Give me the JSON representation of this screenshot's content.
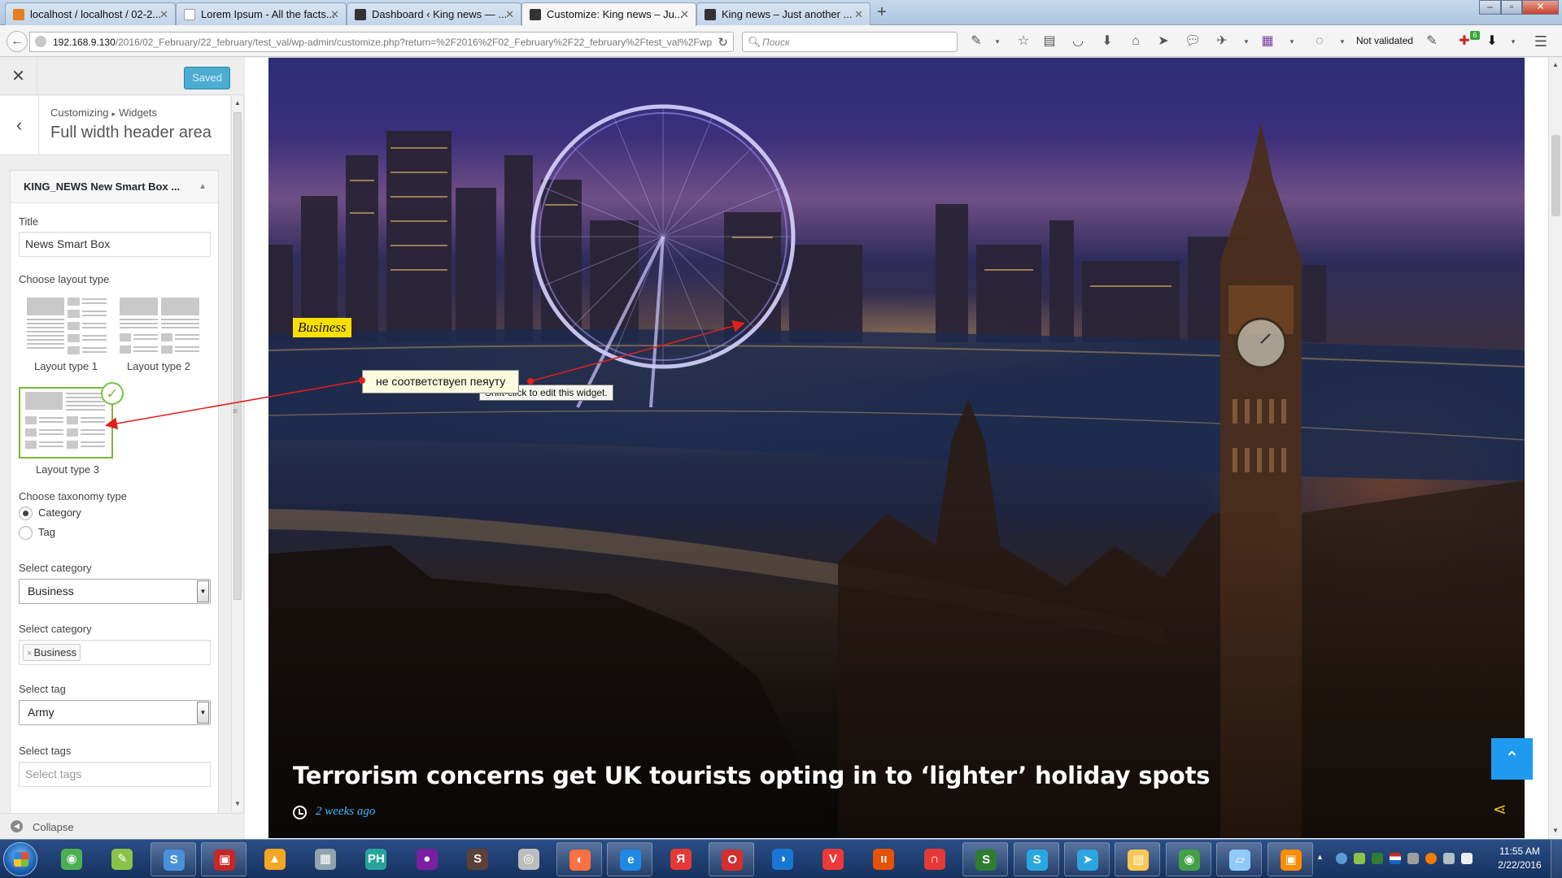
{
  "browser": {
    "tabs": [
      {
        "title": "localhost / localhost / 02-2...",
        "color": "#e67e22"
      },
      {
        "title": "Lorem Ipsum - All the facts...",
        "color": "#ffffff"
      },
      {
        "title": "Dashboard ‹ King news — ...",
        "color": "#333333"
      },
      {
        "title": "Customize: King news – Ju...",
        "color": "#333333",
        "active": true
      },
      {
        "title": "King news – Just another ...",
        "color": "#333333"
      }
    ],
    "new_tab": "+",
    "url_host": "192.168.9.130",
    "url_path": "/2016/02_February/22_february/test_val/wp-admin/customize.php?return=%2F2016%2F02_February%2F22_february%2Ftest_val%2Fwp",
    "search_placeholder": "Поиск",
    "validation_status": "Not validated",
    "notification_count": "6"
  },
  "customizer": {
    "saved_label": "Saved",
    "breadcrumb": [
      "Customizing",
      "Widgets"
    ],
    "section_title": "Full width header area",
    "widget": {
      "title": "KING_NEWS New Smart Box ...",
      "title_field_label": "Title",
      "title_field_value": "News Smart Box",
      "layout_label": "Choose layout type",
      "layouts": [
        "Layout type 1",
        "Layout type 2",
        "Layout type 3"
      ],
      "selected_layout": "Layout type 3",
      "taxonomy_label": "Choose taxonomy type",
      "taxonomy_options": [
        "Category",
        "Tag"
      ],
      "taxonomy_selected": "Category",
      "select_category_label": "Select category",
      "select_category_value": "Business",
      "select_categories_label": "Select category",
      "selected_categories": [
        "Business"
      ],
      "select_tag_label": "Select tag",
      "select_tag_value": "Army",
      "select_tags_label": "Select tags",
      "select_tags_placeholder": "Select tags"
    },
    "collapse_label": "Collapse"
  },
  "preview": {
    "category": "Business",
    "headline": "Terrorism concerns get UK tourists opting in to ‘lighter’ holiday spots",
    "time_ago": "2 weeks ago",
    "edit_tooltip": "Shift-click to edit this widget.",
    "annotation": "не соответствуеп пеяуту",
    "to_top_icon": "chevron-up-icon",
    "share_icon": "share-icon"
  },
  "taskbar": {
    "apps": [
      {
        "name": "chrome",
        "color": "#4caf50",
        "glyph": "◉"
      },
      {
        "name": "notepad",
        "color": "#8bc34a",
        "glyph": "✎"
      },
      {
        "name": "sublime",
        "color": "#4a90d9",
        "glyph": "S"
      },
      {
        "name": "floppy",
        "color": "#c62828",
        "glyph": "▣"
      },
      {
        "name": "avast",
        "color": "#f5a623",
        "glyph": "▲"
      },
      {
        "name": "calculator",
        "color": "#90a4ae",
        "glyph": "▦"
      },
      {
        "name": "tool",
        "color": "#26a69a",
        "glyph": "PH"
      },
      {
        "name": "purple",
        "color": "#7b1fa2",
        "glyph": "●"
      },
      {
        "name": "sublime2",
        "color": "#5d4037",
        "glyph": "S"
      },
      {
        "name": "mask",
        "color": "#bdbdbd",
        "glyph": "◎"
      },
      {
        "name": "firefox",
        "color": "#ff7043",
        "glyph": "◐"
      },
      {
        "name": "ie",
        "color": "#1e88e5",
        "glyph": "e"
      },
      {
        "name": "yandex",
        "color": "#e53935",
        "glyph": "Я"
      },
      {
        "name": "opera",
        "color": "#d32f2f",
        "glyph": "O"
      },
      {
        "name": "firefox2",
        "color": "#1976d2",
        "glyph": "◑"
      },
      {
        "name": "vivaldi",
        "color": "#ef3939",
        "glyph": "V"
      },
      {
        "name": "plugins",
        "color": "#e65100",
        "glyph": "ıı"
      },
      {
        "name": "anydesk",
        "color": "#e53935",
        "glyph": "∩"
      },
      {
        "name": "sapp",
        "color": "#2e7d32",
        "glyph": "S"
      },
      {
        "name": "skype",
        "color": "#29a8e0",
        "glyph": "S"
      },
      {
        "name": "telegram",
        "color": "#2ca5e0",
        "glyph": "➤"
      },
      {
        "name": "explorer",
        "color": "#f9c74f",
        "glyph": "▤"
      },
      {
        "name": "chrome2",
        "color": "#43a047",
        "glyph": "◉"
      },
      {
        "name": "notes",
        "color": "#90caf9",
        "glyph": "▱"
      },
      {
        "name": "photos",
        "color": "#fb8c00",
        "glyph": "▣"
      }
    ],
    "time": "11:55 AM",
    "date": "2/22/2016"
  }
}
